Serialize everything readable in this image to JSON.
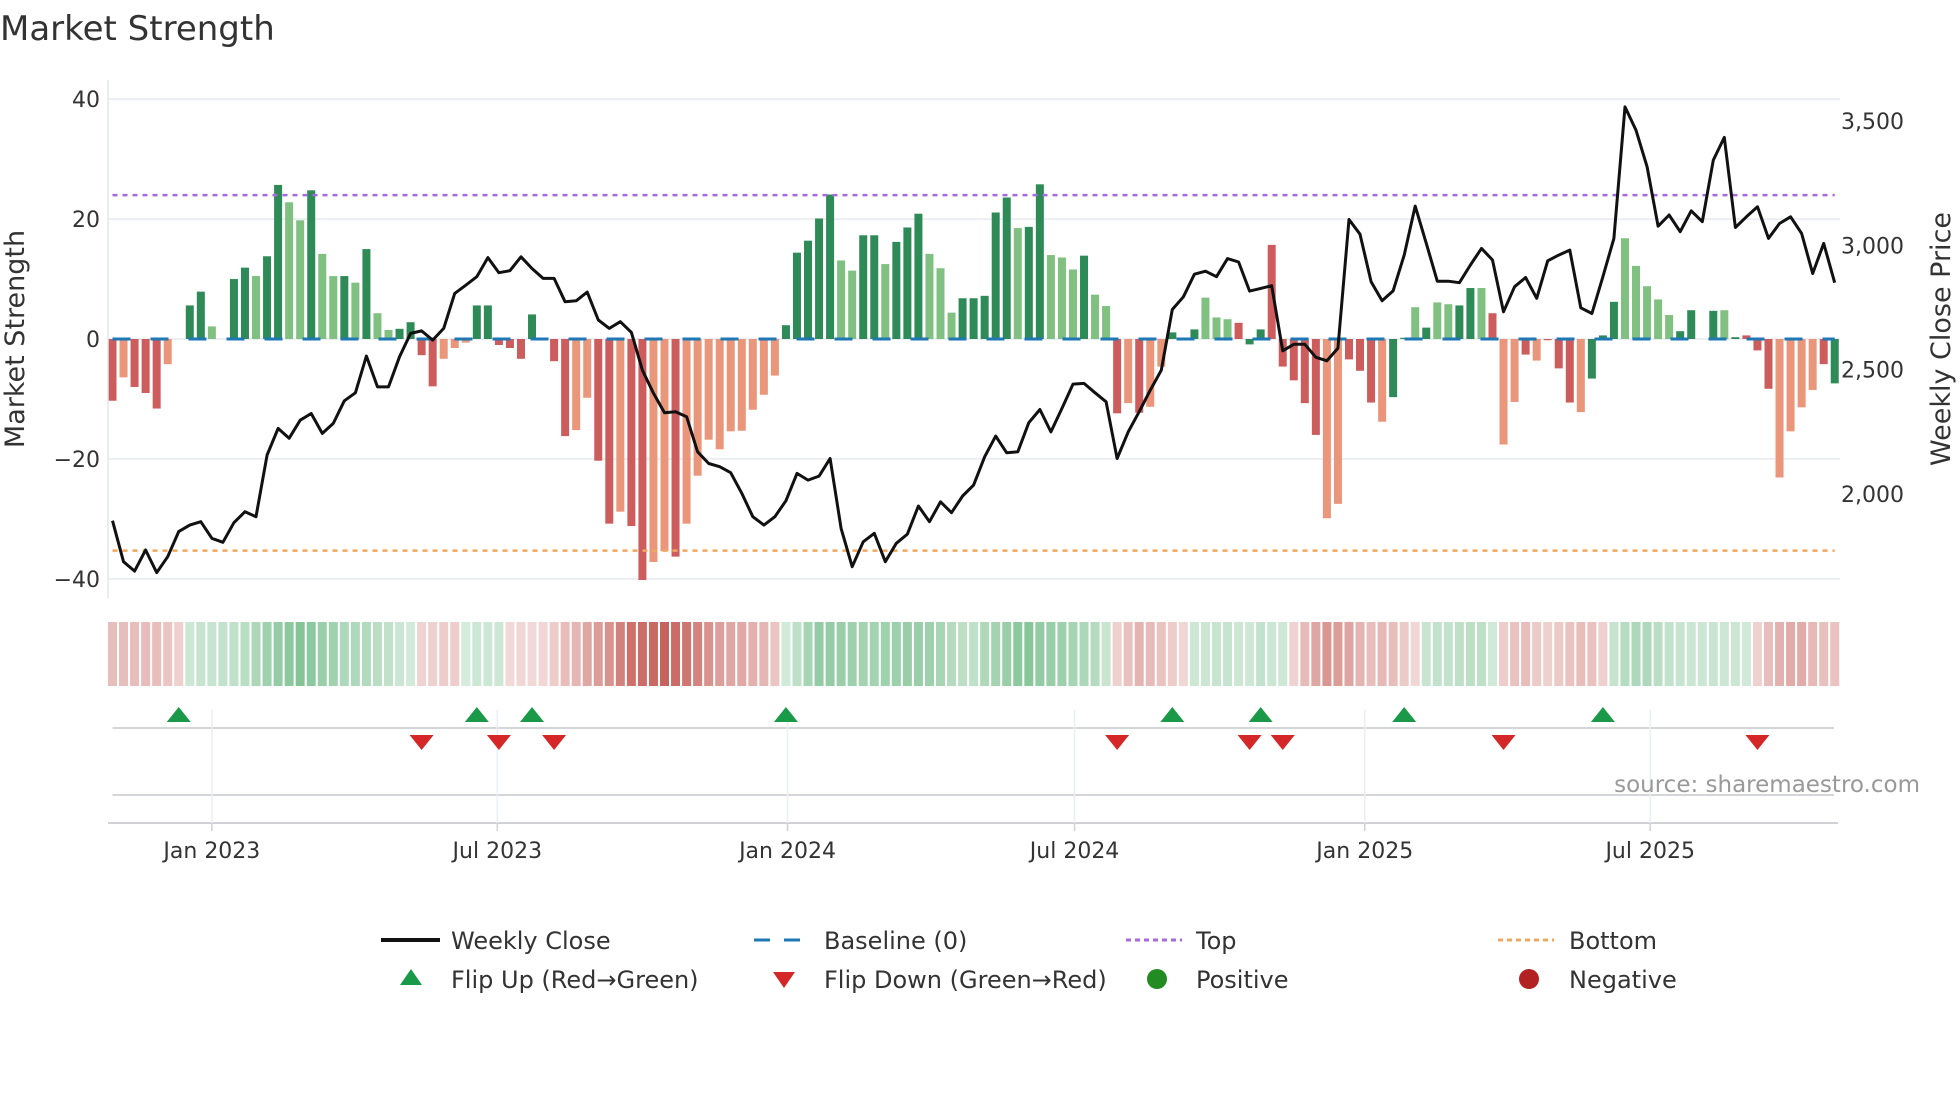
{
  "chart_data": {
    "type": "bar",
    "title": "Market Strength",
    "ylabel": "Market Strength",
    "y2label": "Weekly Close Price",
    "ylim": [
      -43.2,
      43.2
    ],
    "y2lim": [
      1582,
      3665
    ],
    "x_start": "2022-10-30",
    "x_step_days": 7,
    "yticks": [
      {
        "value": 40,
        "label": "40"
      },
      {
        "value": 20,
        "label": "20"
      },
      {
        "value": 0,
        "label": "0"
      },
      {
        "value": -20,
        "label": "−20"
      },
      {
        "value": -40,
        "label": "−40"
      }
    ],
    "y2ticks": [
      {
        "value": 2000,
        "label": "2,000"
      },
      {
        "value": 2500,
        "label": "2,500"
      },
      {
        "value": 3000,
        "label": "3,000"
      },
      {
        "value": 3500,
        "label": "3,500"
      }
    ],
    "xticks": [
      {
        "date": "2023-01-01",
        "label": "Jan 2023"
      },
      {
        "date": "2023-07-01",
        "label": "Jul 2023"
      },
      {
        "date": "2024-01-01",
        "label": "Jan 2024"
      },
      {
        "date": "2024-07-01",
        "label": "Jul 2024"
      },
      {
        "date": "2025-01-01",
        "label": "Jan 2025"
      },
      {
        "date": "2025-07-01",
        "label": "Jul 2025"
      }
    ],
    "top_level": 24,
    "bottom_level": -35.3,
    "strength": [
      -10.3,
      -6.4,
      -8,
      -9,
      -11.6,
      -4.2,
      0,
      5.6,
      7.9,
      2.1,
      0,
      10,
      11.9,
      10.5,
      13.8,
      25.7,
      22.8,
      19.8,
      24.8,
      14.2,
      10.5,
      10.5,
      9.4,
      15,
      4.3,
      1.5,
      1.7,
      2.8,
      -2.7,
      -7.9,
      -3.3,
      -1.5,
      -0.6,
      5.6,
      5.6,
      -1,
      -1.5,
      -3.3,
      4.1,
      0,
      -3.7,
      -16.2,
      -15.2,
      -9.8,
      -20.3,
      -30.8,
      -28.8,
      -31.2,
      -40.2,
      -37.2,
      -35.4,
      -36.3,
      -30.8,
      -22.8,
      -16.8,
      -18.4,
      -15.4,
      -15.3,
      -11.8,
      -9.3,
      -6.1,
      2.3,
      14.4,
      16.4,
      20.1,
      24.1,
      13.1,
      11.4,
      17.3,
      17.3,
      12.5,
      16.2,
      18.6,
      20.9,
      14.2,
      11.8,
      4.4,
      6.8,
      6.8,
      7.2,
      21.1,
      23.6,
      18.5,
      18.7,
      25.8,
      14,
      13.6,
      11.6,
      13.9,
      7.4,
      5.5,
      -12.4,
      -10.7,
      -12.3,
      -11.3,
      -4.6,
      1.1,
      0,
      1.6,
      6.9,
      3.6,
      3.3,
      2.7,
      -0.9,
      1.6,
      15.7,
      -4.6,
      -6.9,
      -10.7,
      -16,
      -29.9,
      -27.5,
      -3.4,
      -5.3,
      -10.6,
      -13.8,
      -9.7,
      0.2,
      5.3,
      1.9,
      6.1,
      5.8,
      5.6,
      8.5,
      8.5,
      4.3,
      -17.6,
      -10.5,
      -2.6,
      -3.6,
      -0.2,
      -4.9,
      -10.6,
      -12.2,
      -6.6,
      0.6,
      6.2,
      16.8,
      12.2,
      8.8,
      6.6,
      4,
      1.3,
      4.8,
      0,
      4.7,
      4.8,
      0.3,
      0.6,
      -1.9,
      -8.3,
      -23.1,
      -15.4,
      -11.4,
      -8.5,
      -4.2,
      -7.4
    ],
    "strength_shade": "RrRRRrGGGgGGGgGGggGggGgGggGGRRrrrGGRRRGGRRrrRRrRRrrRrrrrrrrrrGGGGGggGGgGGGgggGGGGGgGGgggGggRrRrrGGGgggRGGRRRRRrrRRRrGGgGggGGgRrrRrRRRrGGGgggggGGGGgGRRRrrrrR",
    "weekly_close": [
      1893,
      1728,
      1690,
      1775,
      1684,
      1748,
      1849,
      1875,
      1889,
      1822,
      1806,
      1885,
      1929,
      1909,
      2157,
      2264,
      2224,
      2297,
      2324,
      2244,
      2284,
      2375,
      2407,
      2555,
      2431,
      2431,
      2552,
      2646,
      2656,
      2619,
      2666,
      2807,
      2840,
      2874,
      2951,
      2890,
      2898,
      2954,
      2907,
      2867,
      2867,
      2773,
      2777,
      2812,
      2700,
      2666,
      2693,
      2650,
      2498,
      2405,
      2327,
      2331,
      2311,
      2170,
      2123,
      2110,
      2086,
      2003,
      1909,
      1875,
      1909,
      1973,
      2083,
      2056,
      2072,
      2143,
      1862,
      1708,
      1808,
      1842,
      1728,
      1802,
      1839,
      1952,
      1889,
      1969,
      1925,
      1992,
      2036,
      2150,
      2233,
      2166,
      2170,
      2287,
      2340,
      2250,
      2344,
      2442,
      2445,
      2407,
      2371,
      2143,
      2250,
      2331,
      2418,
      2498,
      2742,
      2793,
      2884,
      2896,
      2874,
      2947,
      2933,
      2816,
      2827,
      2838,
      2576,
      2602,
      2602,
      2550,
      2536,
      2586,
      3104,
      3045,
      2854,
      2777,
      2817,
      2961,
      3158,
      3008,
      2856,
      2856,
      2850,
      2921,
      2988,
      2941,
      2733,
      2834,
      2871,
      2787,
      2938,
      2961,
      2981,
      2749,
      2726,
      2874,
      3028,
      3557,
      3463,
      3316,
      3077,
      3122,
      3055,
      3139,
      3095,
      3343,
      3434,
      3072,
      3115,
      3155,
      3028,
      3088,
      3115,
      3048,
      2887,
      3008,
      2850
    ],
    "flip_up_weeks": [
      6,
      33,
      38,
      61,
      96,
      104,
      117,
      135
    ],
    "flip_down_weeks": [
      28,
      35,
      40,
      91,
      103,
      106,
      126,
      149
    ],
    "colors": {
      "strong_positive": "#2e8b57",
      "weak_positive": "#80c080",
      "strong_negative": "#cd5c5c",
      "weak_negative": "#e9967a",
      "weekly_close": "#111111",
      "baseline": "#1f77b4",
      "top": "#a66bdd",
      "bottom": "#f0a860",
      "flip_up": "#1a9a48",
      "flip_down": "#d62728",
      "positive": "#228b22",
      "negative": "#b22222"
    },
    "legend": {
      "placement": "bottom",
      "items": [
        {
          "label": "Weekly Close"
        },
        {
          "label": "Baseline (0)"
        },
        {
          "label": "Top"
        },
        {
          "label": "Bottom"
        },
        {
          "label": "Flip Up (Red→Green)"
        },
        {
          "label": "Flip Down (Green→Red)"
        },
        {
          "label": "Positive"
        },
        {
          "label": "Negative"
        }
      ]
    },
    "source": "source: sharemaestro.com"
  }
}
